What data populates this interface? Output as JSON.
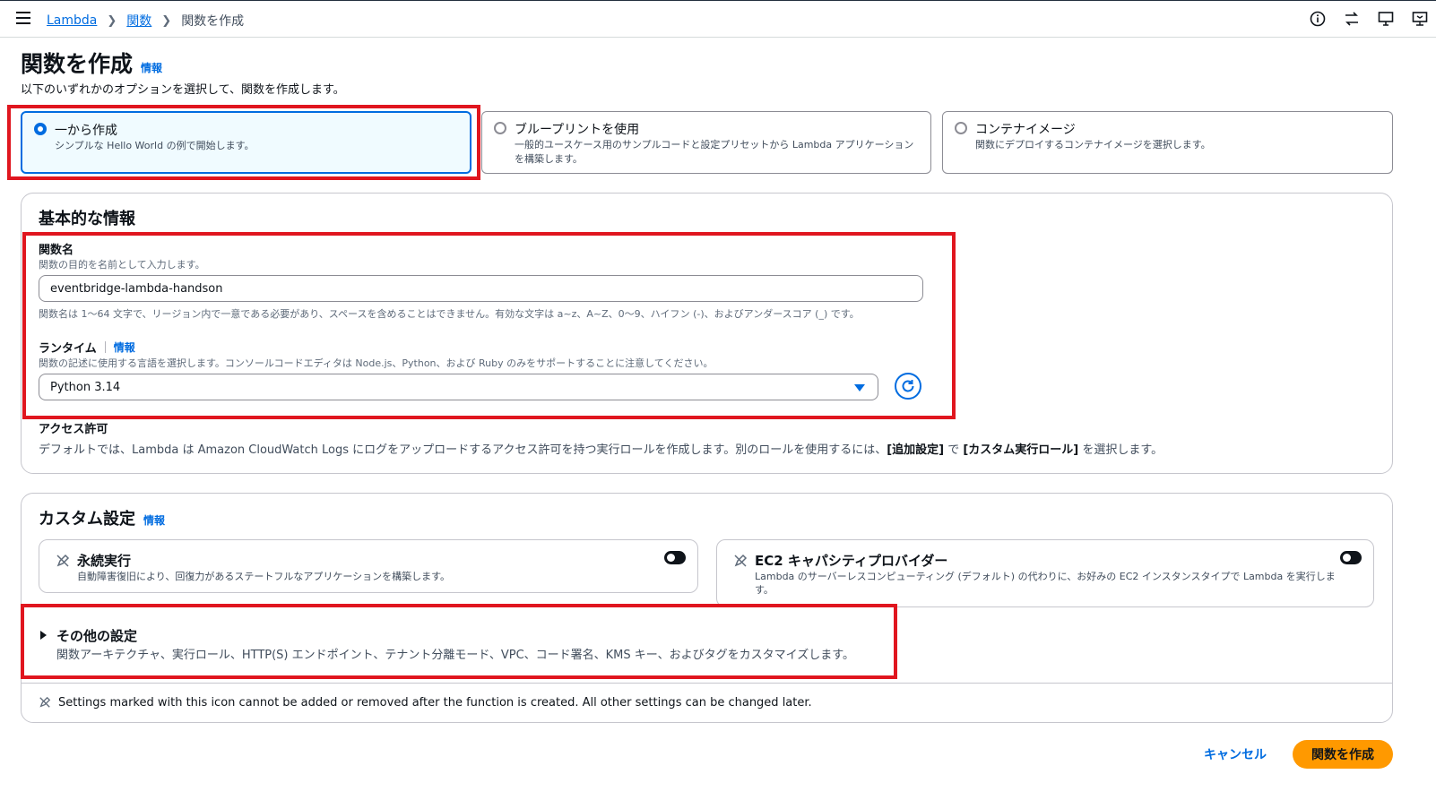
{
  "breadcrumb": {
    "root": "Lambda",
    "parent": "関数",
    "current": "関数を作成"
  },
  "header": {
    "title": "関数を作成",
    "info": "情報",
    "subtitle": "以下のいずれかのオプションを選択して、関数を作成します。"
  },
  "options": [
    {
      "title": "一から作成",
      "desc": "シンプルな Hello World の例で開始します。",
      "selected": true
    },
    {
      "title": "ブループリントを使用",
      "desc": "一般的ユースケース用のサンプルコードと設定プリセットから Lambda アプリケーションを構築します。",
      "selected": false
    },
    {
      "title": "コンテナイメージ",
      "desc": "関数にデプロイするコンテナイメージを選択します。",
      "selected": false
    }
  ],
  "basic": {
    "heading": "基本的な情報",
    "fn_name_label": "関数名",
    "fn_name_desc": "関数の目的を名前として入力します。",
    "fn_name_value": "eventbridge-lambda-handson",
    "fn_name_hint": "関数名は 1〜64 文字で、リージョン内で一意である必要があり、スペースを含めることはできません。有効な文字は a~z、A~Z、0〜9、ハイフン (-)、およびアンダースコア (_) です。",
    "runtime_label": "ランタイム",
    "runtime_info": "情報",
    "runtime_desc": "関数の記述に使用する言語を選択します。コンソールコードエディタは Node.js、Python、および Ruby のみをサポートすることに注意してください。",
    "runtime_value": "Python 3.14",
    "access_label": "アクセス許可",
    "access_desc_1": "デフォルトでは、Lambda は Amazon CloudWatch Logs にログをアップロードするアクセス許可を持つ実行ロールを作成します。別のロールを使用するには、",
    "access_bold_1": "[追加設定]",
    "access_desc_2": " で ",
    "access_bold_2": "[カスタム実行ロール]",
    "access_desc_3": " を選択します。"
  },
  "custom": {
    "heading": "カスタム設定",
    "info": "情報",
    "durable_title": "永続実行",
    "durable_desc": "自動障害復旧により、回復力があるステートフルなアプリケーションを構築します。",
    "ec2_title": "EC2 キャパシティプロバイダー",
    "ec2_desc": "Lambda のサーバーレスコンピューティング (デフォルト) の代わりに、お好みの EC2 インスタンスタイプで Lambda を実行します。",
    "other_title": "その他の設定",
    "other_desc": "関数アーキテクチャ、実行ロール、HTTP(S) エンドポイント、テナント分離モード、VPC、コード署名、KMS キー、およびタグをカスタマイズします。",
    "footnote": "Settings marked with this icon cannot be added or removed after the function is created. All other settings can be changed later."
  },
  "actions": {
    "cancel": "キャンセル",
    "create": "関数を作成"
  },
  "colors": {
    "accent": "#006ce0",
    "primary_button": "#ff9900",
    "highlight": "#e0161f"
  }
}
